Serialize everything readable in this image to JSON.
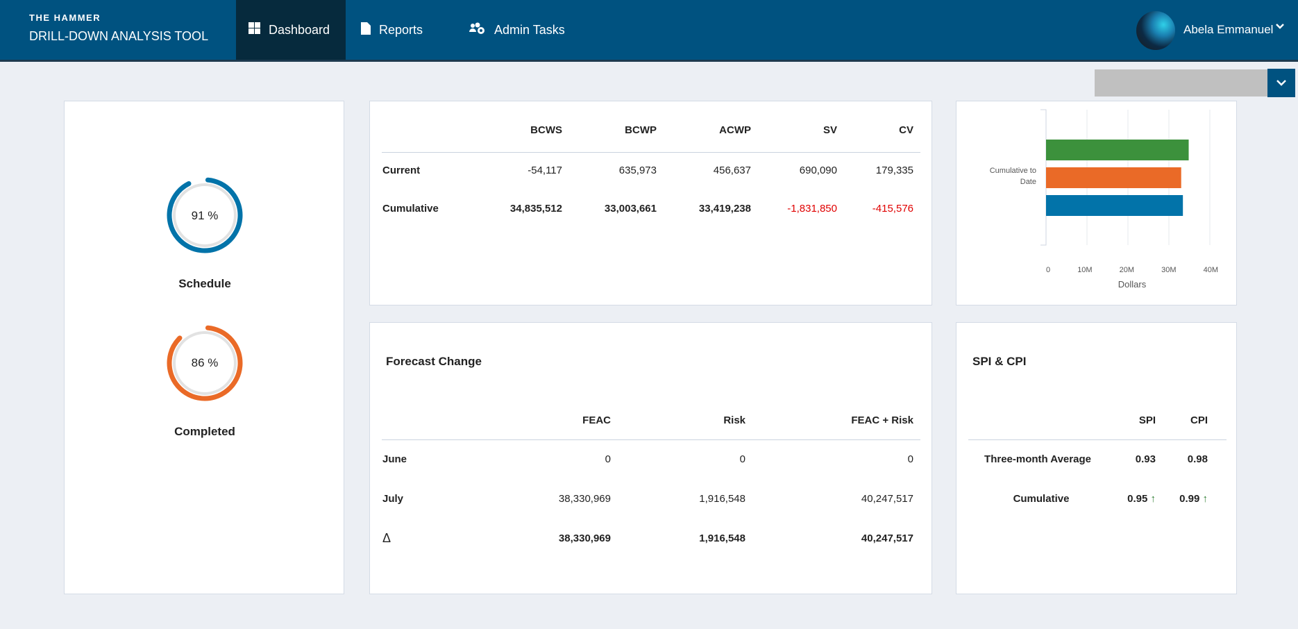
{
  "header": {
    "brand_top": "THE HAMMER",
    "brand_bottom": "DRILL-DOWN ANALYSIS TOOL",
    "nav": [
      {
        "label": "Dashboard",
        "icon": "windows-grid-icon",
        "active": true
      },
      {
        "label": "Reports",
        "icon": "document-icon"
      },
      {
        "label": "Admin Tasks",
        "icon": "users-cog-icon"
      }
    ],
    "user": {
      "name": "Abela Emmanuel"
    }
  },
  "colors": {
    "header": "#005280",
    "active_tab": "#062a3d",
    "blue": "#0273a9",
    "orange": "#ea6a27",
    "green": "#3c913c",
    "negative": "#e00000",
    "up_arrow": "#2e7d32"
  },
  "gauges": [
    {
      "label": "Schedule",
      "value": 91,
      "text": "91 %",
      "color": "#0273a9"
    },
    {
      "label": "Completed",
      "value": 86,
      "text": "86 %",
      "color": "#ea6a27"
    }
  ],
  "earned_value": {
    "columns": [
      "BCWS",
      "BCWP",
      "ACWP",
      "SV",
      "CV"
    ],
    "rows": [
      {
        "label": "Current",
        "values": [
          "-54,117",
          "635,973",
          "456,637",
          "690,090",
          "179,335"
        ],
        "negative": [
          false,
          false,
          false,
          false,
          false
        ]
      },
      {
        "label": "Cumulative",
        "values": [
          "34,835,512",
          "33,003,661",
          "33,419,238",
          "-1,831,850",
          "-415,576"
        ],
        "negative": [
          false,
          false,
          false,
          true,
          true
        ]
      }
    ]
  },
  "chart_data": {
    "type": "bar",
    "orientation": "horizontal",
    "categories": [
      "Cumulative to Date"
    ],
    "series": [
      {
        "values": [
          34835512
        ],
        "color": "#3c913c"
      },
      {
        "values": [
          33003661
        ],
        "color": "#ea6a27"
      },
      {
        "values": [
          33419238
        ],
        "color": "#0273a9"
      }
    ],
    "xlabel": "Dollars",
    "xlim": [
      0,
      40000000
    ],
    "ticks": [
      "0",
      "10M",
      "20M",
      "30M",
      "40M"
    ],
    "grid": true
  },
  "forecast": {
    "title": "Forecast Change",
    "columns": [
      "FEAC",
      "Risk",
      "FEAC + Risk"
    ],
    "rows": [
      {
        "label": "June",
        "values": [
          "0",
          "0",
          "0"
        ]
      },
      {
        "label": "July",
        "values": [
          "38,330,969",
          "1,916,548",
          "40,247,517"
        ]
      },
      {
        "label": "Δ",
        "values": [
          "38,330,969",
          "1,916,548",
          "40,247,517"
        ],
        "bold": true
      }
    ]
  },
  "spi_cpi": {
    "title": "SPI & CPI",
    "columns": [
      "SPI",
      "CPI"
    ],
    "rows": [
      {
        "label": "Three-month Average",
        "values": [
          "0.93",
          "0.98"
        ]
      },
      {
        "label": "Cumulative",
        "values": [
          "0.95",
          "0.99"
        ],
        "trend": "up"
      }
    ]
  }
}
